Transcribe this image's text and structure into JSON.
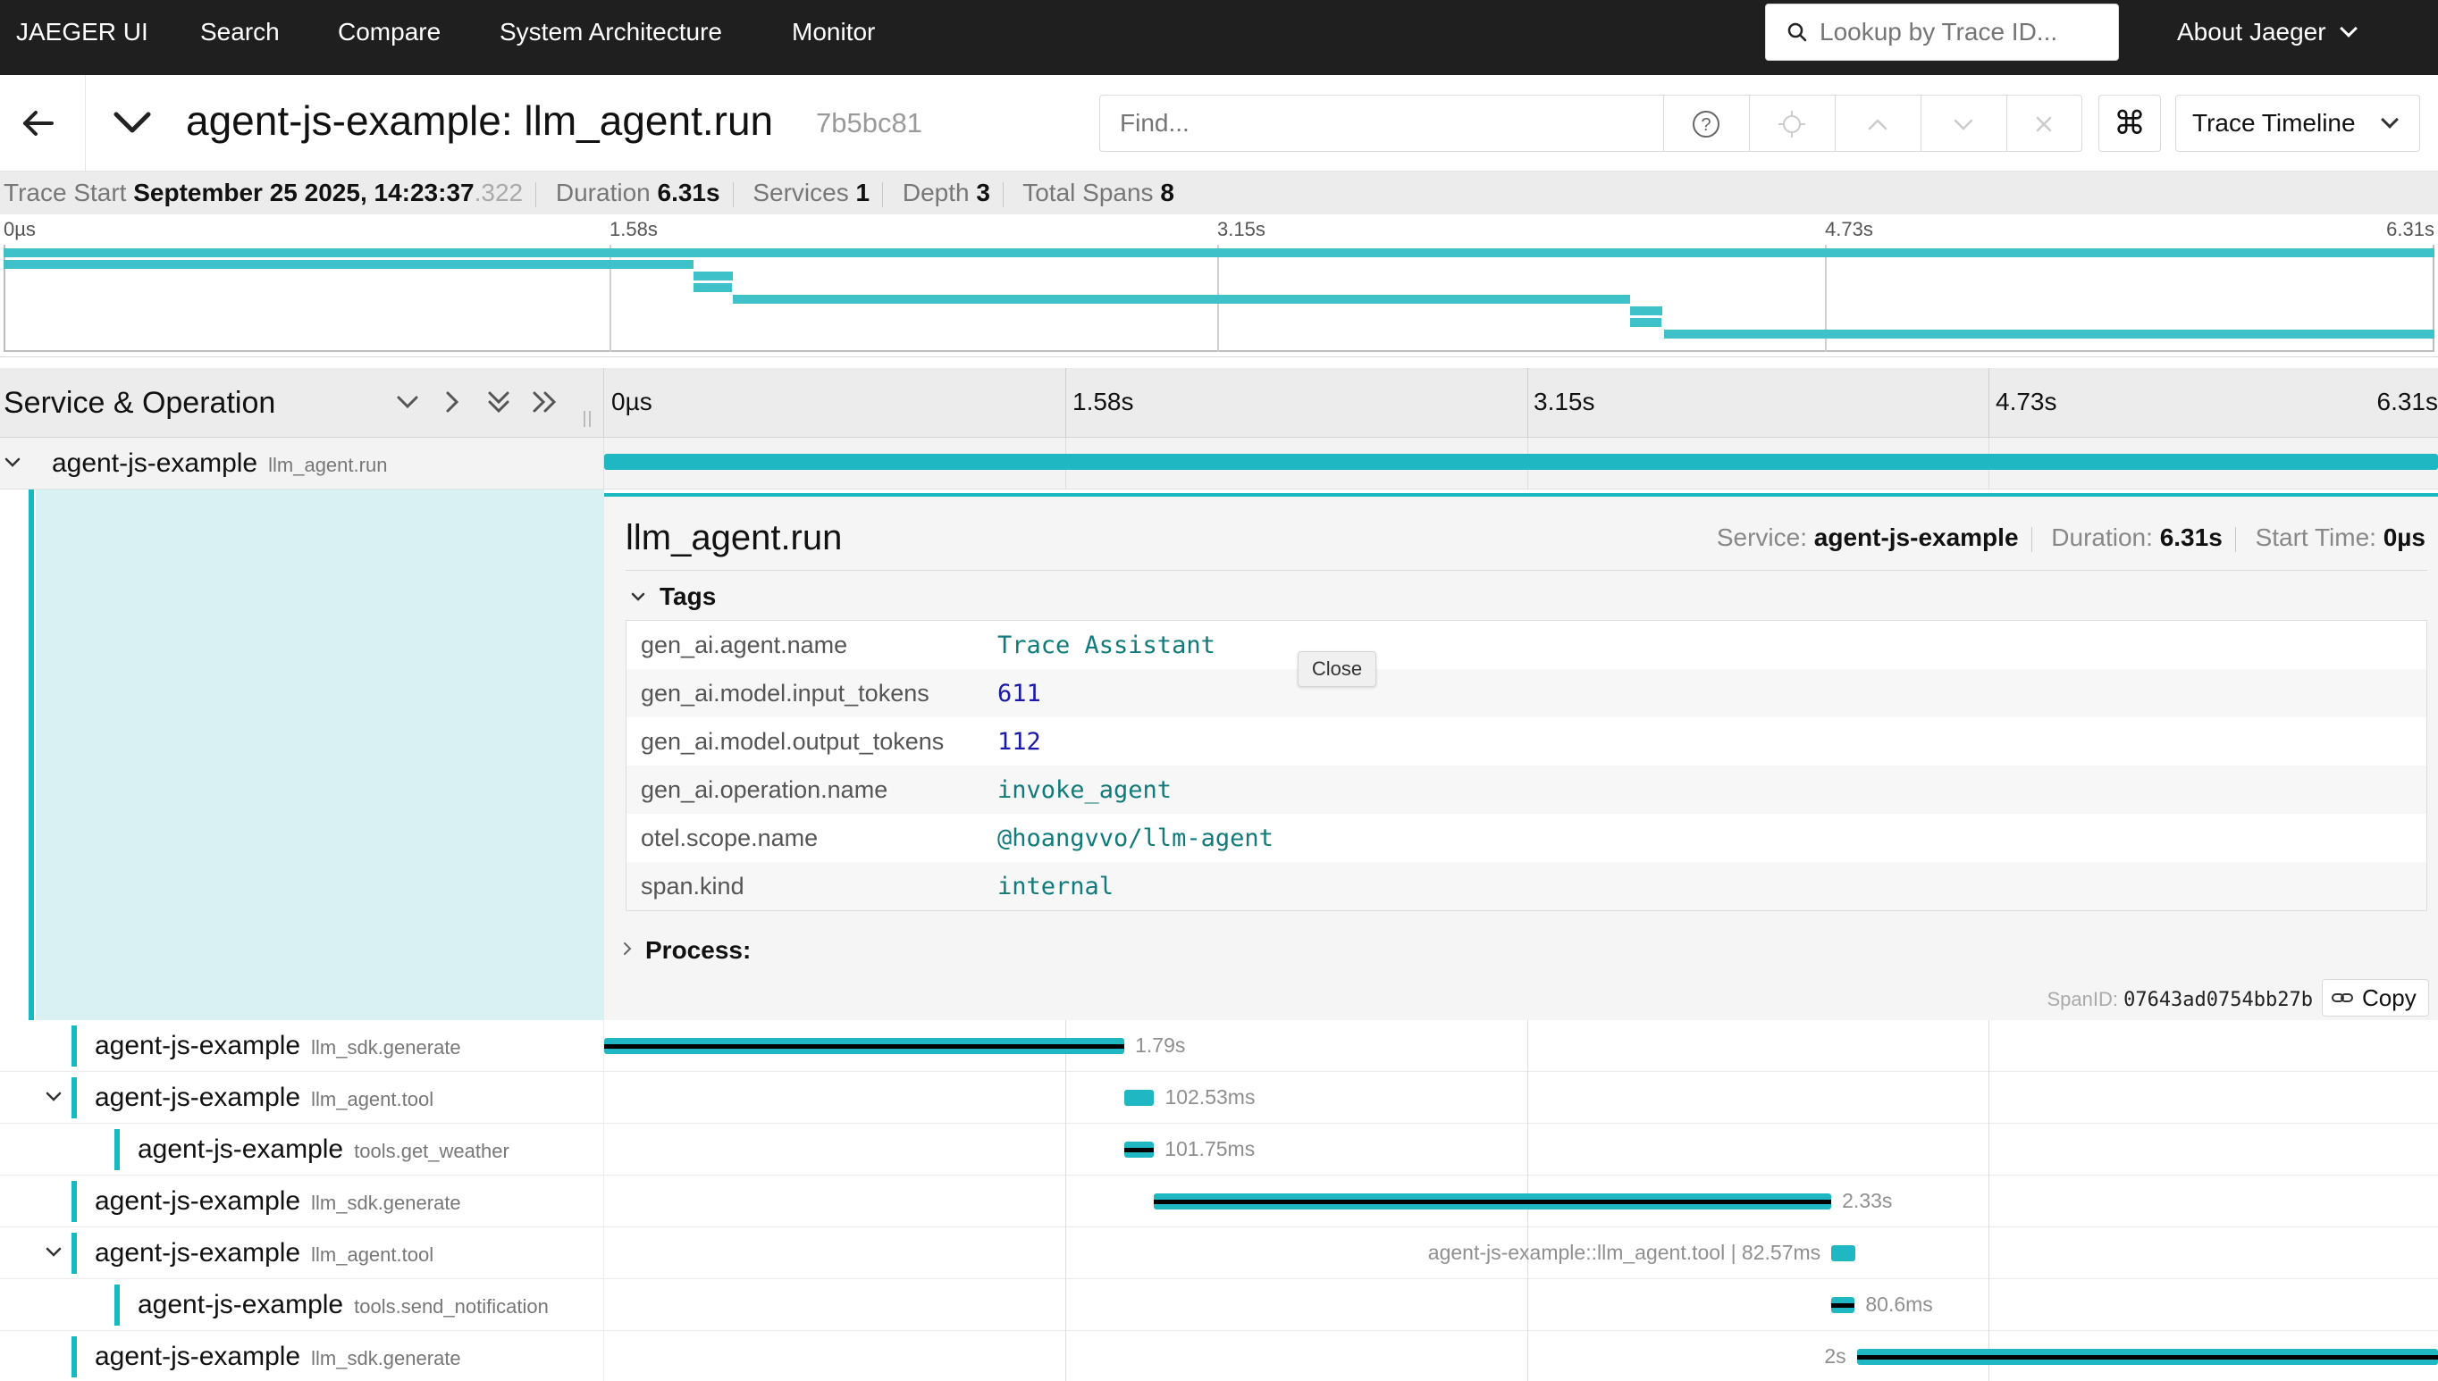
{
  "nav": {
    "brand": "JAEGER UI",
    "items": [
      "Search",
      "Compare",
      "System Architecture",
      "Monitor"
    ],
    "lookup_placeholder": "Lookup by Trace ID...",
    "about": "About Jaeger"
  },
  "trace": {
    "title": "agent-js-example: llm_agent.run",
    "id": "7b5bc81",
    "find_placeholder": "Find...",
    "keyboard_glyph": "⌘",
    "view": "Trace Timeline"
  },
  "summary": {
    "start_label": "Trace Start",
    "start_value": "September 25 2025, 14:23:37",
    "start_ms": ".322",
    "duration_label": "Duration",
    "duration_value": "6.31s",
    "services_label": "Services",
    "services_value": "1",
    "depth_label": "Depth",
    "depth_value": "3",
    "spans_label": "Total Spans",
    "spans_value": "8"
  },
  "minimap_ticks": [
    "0µs",
    "1.58s",
    "3.15s",
    "4.73s",
    "6.31s"
  ],
  "timeline": {
    "column_title": "Service & Operation",
    "ticks": [
      "0µs",
      "1.58s",
      "3.15s",
      "4.73s",
      "6.31s"
    ],
    "total_seconds": 6.31
  },
  "spans": [
    {
      "service": "agent-js-example",
      "operation": "llm_agent.run",
      "start": 0,
      "duration": 6.31,
      "label": ""
    },
    {
      "service": "agent-js-example",
      "operation": "llm_sdk.generate",
      "start": 0,
      "duration": 1.79,
      "label": "1.79s"
    },
    {
      "service": "agent-js-example",
      "operation": "llm_agent.tool",
      "start": 1.79,
      "duration": 0.10253,
      "label": "102.53ms"
    },
    {
      "service": "agent-js-example",
      "operation": "tools.get_weather",
      "start": 1.79,
      "duration": 0.10175,
      "label": "101.75ms"
    },
    {
      "service": "agent-js-example",
      "operation": "llm_sdk.generate",
      "start": 1.8925,
      "duration": 2.33,
      "label": "2.33s"
    },
    {
      "service": "agent-js-example",
      "operation": "llm_agent.tool",
      "start": 4.2225,
      "duration": 0.08257,
      "label": "agent-js-example::llm_agent.tool | 82.57ms"
    },
    {
      "service": "agent-js-example",
      "operation": "tools.send_notification",
      "start": 4.2225,
      "duration": 0.0806,
      "label": "80.6ms"
    },
    {
      "service": "agent-js-example",
      "operation": "llm_sdk.generate",
      "start": 4.31,
      "duration": 2.0,
      "label": "2s"
    }
  ],
  "detail": {
    "title": "llm_agent.run",
    "service_label": "Service:",
    "service_value": "agent-js-example",
    "duration_label": "Duration:",
    "duration_value": "6.31s",
    "start_label": "Start Time:",
    "start_value": "0µs",
    "tags_heading": "Tags",
    "tags": [
      {
        "key": "gen_ai.agent.name",
        "value": "Trace Assistant",
        "numeric": false
      },
      {
        "key": "gen_ai.model.input_tokens",
        "value": "611",
        "numeric": true
      },
      {
        "key": "gen_ai.model.output_tokens",
        "value": "112",
        "numeric": true
      },
      {
        "key": "gen_ai.operation.name",
        "value": "invoke_agent",
        "numeric": false
      },
      {
        "key": "otel.scope.name",
        "value": "@hoangvvo/llm-agent",
        "numeric": false
      },
      {
        "key": "span.kind",
        "value": "internal",
        "numeric": false
      }
    ],
    "process_heading": "Process:",
    "span_id_label": "SpanID:",
    "span_id_value": "07643ad0754bb27b",
    "copy_label": "Copy",
    "tooltip": "Close"
  },
  "colors": {
    "accent": "#17b8be",
    "nav_bg": "#1f1f1f",
    "critical_path": "#000000"
  }
}
